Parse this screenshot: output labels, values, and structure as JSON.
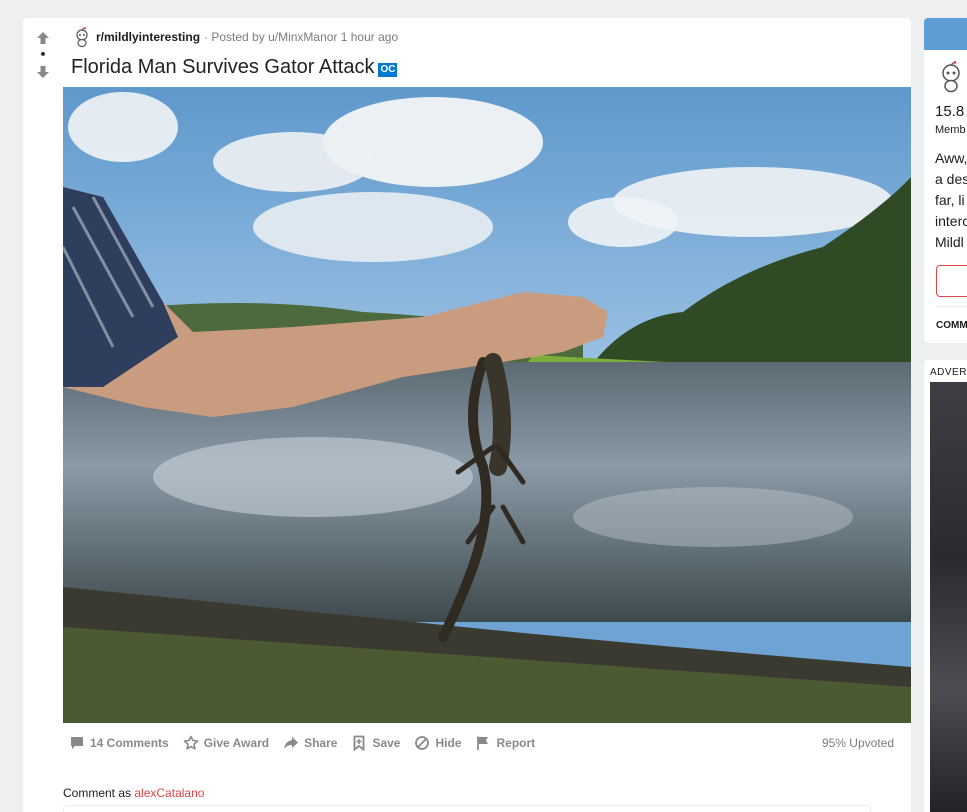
{
  "post": {
    "subreddit": "r/mildlyinteresting",
    "posted_by": "· Posted by u/MinxManor 1 hour ago",
    "title": "Florida Man Survives Gator Attack",
    "flair": "OC",
    "vote_score": "•",
    "actions": [
      {
        "label": "14 Comments",
        "icon": "comment-icon"
      },
      {
        "label": "Give Award",
        "icon": "award-icon"
      },
      {
        "label": "Share",
        "icon": "share-icon"
      },
      {
        "label": "Save",
        "icon": "save-icon"
      },
      {
        "label": "Hide",
        "icon": "hide-icon"
      },
      {
        "label": "Report",
        "icon": "report-flag-icon"
      }
    ],
    "upvoted": "95% Upvoted",
    "comment_as_prefix": "Comment as",
    "comment_as_user": "alexCatalano"
  },
  "sidebar": {
    "count": "15.8",
    "members": "Memb",
    "description": [
      "Aww,",
      "a des",
      "far, li",
      "interc",
      "Mildl"
    ],
    "comm": "COMM",
    "ad_label": "ADVERT"
  },
  "colors": {
    "accent": "#0079d3",
    "username": "#e0454a",
    "action_text": "#878a8c"
  }
}
